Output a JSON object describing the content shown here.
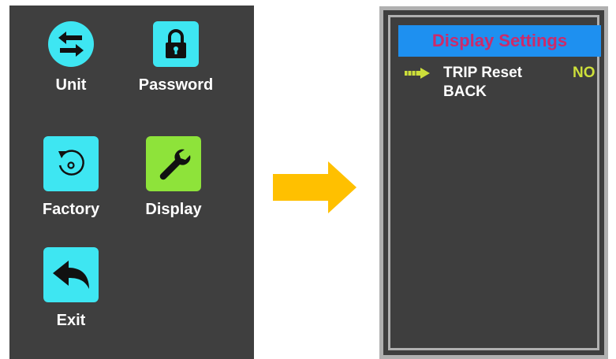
{
  "menu": {
    "items": [
      {
        "label": "Unit",
        "icon": "swap-arrows-icon",
        "tile_color": "#3ee6f2"
      },
      {
        "label": "Password",
        "icon": "padlock-icon",
        "tile_color": "#3ee6f2"
      },
      {
        "label": "Factory",
        "icon": "reset-rotate-icon",
        "tile_color": "#3ee6f2"
      },
      {
        "label": "Display",
        "icon": "wrench-icon",
        "tile_color": "#8ee33a"
      },
      {
        "label": "Exit",
        "icon": "return-arrow-icon",
        "tile_color": "#3ee6f2"
      }
    ]
  },
  "transition": {
    "icon": "right-arrow-icon",
    "color": "#ffc000"
  },
  "screen": {
    "title": "Display Settings",
    "title_bg": "#1e90f0",
    "title_color": "#cc2b6a",
    "rows": [
      {
        "label": "TRIP Reset",
        "value": "NO",
        "selected": true
      },
      {
        "label": "BACK",
        "value": "",
        "selected": false
      }
    ],
    "selector_icon": "selection-arrow-icon"
  }
}
